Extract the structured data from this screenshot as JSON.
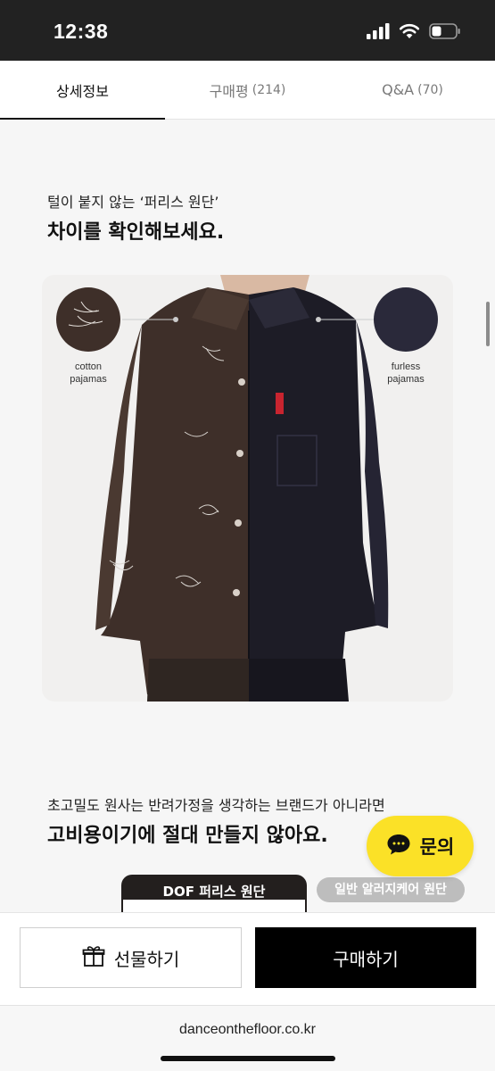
{
  "status_bar": {
    "time": "12:38",
    "battery_level": 0.4
  },
  "tabs": [
    {
      "label": "상세정보",
      "count": ""
    },
    {
      "label": "구매평",
      "count": "(214)"
    },
    {
      "label": "Q&A",
      "count": "(70)"
    }
  ],
  "intro": {
    "subtitle": "털이 붙지 않는 ‘퍼리스 원단’",
    "headline": "차이를 확인해보세요."
  },
  "photo": {
    "left_label_1": "cotton",
    "left_label_2": "pajamas",
    "right_label_1": "furless",
    "right_label_2": "pajamas"
  },
  "section2": {
    "subtitle": "초고밀도 원사는 반려가정을 생각하는 브랜드가 아니라면",
    "headline": "고비용이기에 절대 만들지 않아요."
  },
  "chat": {
    "label": "문의"
  },
  "compare": {
    "dof_label": "DOF 퍼리스 원단",
    "normal_label": "일반 알러지케어 원단"
  },
  "bottom": {
    "gift_label": "선물하기",
    "buy_label": "구매하기"
  },
  "url": "danceonthefloor.co.kr",
  "colors": {
    "status_bar": "#222222",
    "chat_yellow": "#fbe127",
    "buy_black": "#000000",
    "dof_dark": "#231f1e"
  },
  "icons": [
    "signal-icon",
    "wifi-icon",
    "battery-icon",
    "chat-bubble-icon",
    "gift-icon"
  ]
}
